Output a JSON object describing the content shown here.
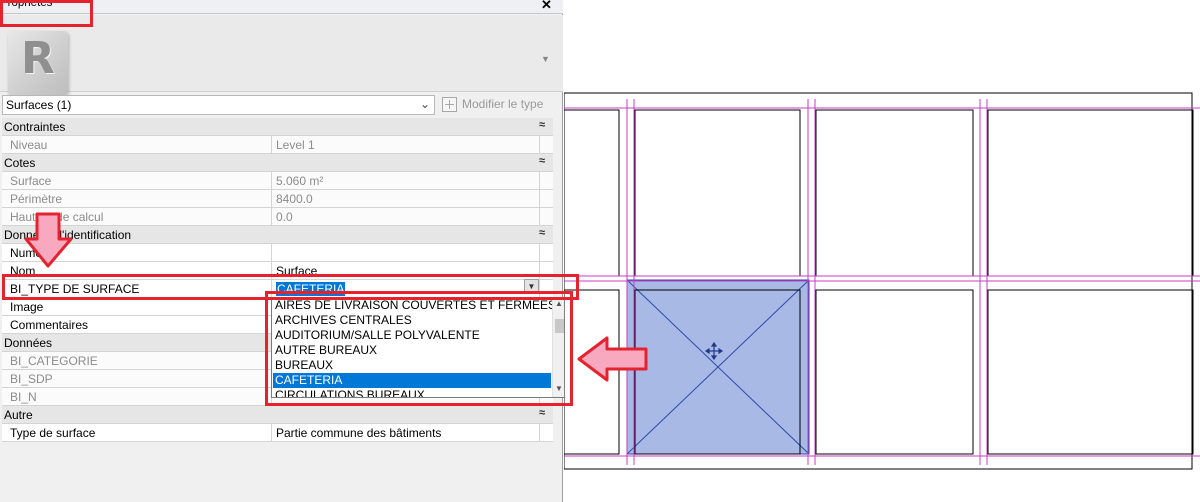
{
  "panel": {
    "title": "Propriétés",
    "close_glyph": "✕",
    "type_logo_letter": "R",
    "selector_label": "Surfaces (1)",
    "edit_type_label": "Modifier le type"
  },
  "groups": {
    "contraintes": "Contraintes",
    "cotes": "Cotes",
    "donnees_identification": "Données d'identification",
    "donnees": "Données",
    "autre": "Autre"
  },
  "props": {
    "niveau": {
      "name": "Niveau",
      "value": "Level 1"
    },
    "surface": {
      "name": "Surface",
      "value": "5.060 m²"
    },
    "perimetre": {
      "name": "Périmètre",
      "value": "8400.0"
    },
    "hauteur": {
      "name": "Hauteur de calcul",
      "value": "0.0"
    },
    "numero": {
      "name": "Numéro",
      "value": ""
    },
    "nom": {
      "name": "Nom",
      "value": "Surface"
    },
    "bi_type": {
      "name": "BI_TYPE DE SURFACE",
      "value": "CAFETERIA"
    },
    "image": {
      "name": "Image",
      "value": ""
    },
    "commentaires": {
      "name": "Commentaires",
      "value": ""
    },
    "bi_categorie": {
      "name": "BI_CATEGORIE",
      "value": ""
    },
    "bi_sdp": {
      "name": "BI_SDP",
      "value": ""
    },
    "bi_n": {
      "name": "BI_N",
      "value": ""
    },
    "type_surface": {
      "name": "Type de surface",
      "value": "Partie commune des bâtiments"
    }
  },
  "dropdown": {
    "options": [
      "AIRES DE LIVRAISON COUVERTES ET FERMEES",
      "ARCHIVES CENTRALES",
      "AUDITORIUM/SALLE POLYVALENTE",
      "AUTRE BUREAUX",
      "BUREAUX",
      "CAFETERIA",
      "CIRCULATIONS BUREAUX"
    ],
    "selected": "CAFETERIA"
  },
  "colors": {
    "annotation_red": "#e4232f",
    "annotation_pink": "#f8a8bf",
    "selection_blue": "#0078d7",
    "grid_magenta": "#c83cc8",
    "area_fill": "#a9b9e6",
    "area_line": "#2b4aa8"
  }
}
